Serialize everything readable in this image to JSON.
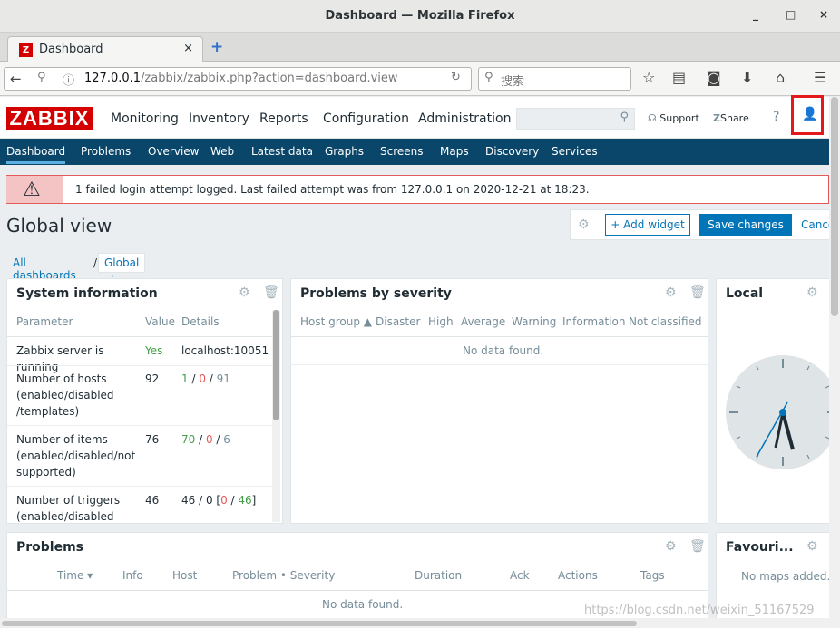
{
  "window": {
    "title": "Dashboard — Mozilla Firefox",
    "controls": [
      "_",
      "□",
      "×"
    ]
  },
  "tab": {
    "favicon": "Z",
    "label": "Dashboard",
    "close": "×",
    "new_tab": "+"
  },
  "nav": {
    "url_host": "127.0.0.1",
    "url_path": "/zabbix/zabbix.php?action=dashboard.view",
    "search_placeholder": "搜索",
    "icons": [
      "back-arrow-icon",
      "site-info-icon",
      "reload-icon",
      "bookmark-star-icon",
      "reading-list-icon",
      "pocket-icon",
      "download-icon",
      "home-icon",
      "menu-icon"
    ]
  },
  "zabbix": {
    "logo": "ZABBIX",
    "menu": [
      "Monitoring",
      "Inventory",
      "Reports",
      "Configuration",
      "Administration"
    ],
    "support": "Support",
    "share": "Share",
    "help": "?",
    "submenu": [
      "Dashboard",
      "Problems",
      "Overview",
      "Web",
      "Latest data",
      "Graphs",
      "Screens",
      "Maps",
      "Discovery",
      "Services"
    ]
  },
  "alert": {
    "message": "1 failed login attempt logged. Last failed attempt was from 127.0.0.1 on 2020-12-21 at 18:23."
  },
  "page": {
    "title": "Global view",
    "add_widget": "+ Add widget",
    "save_changes": "Save changes",
    "cancel": "Cance",
    "crumbs": {
      "all": "All dashboards",
      "sep": "/",
      "current": "Global view"
    }
  },
  "sysinfo": {
    "title": "System information",
    "headers": [
      "Parameter",
      "Value",
      "Details"
    ],
    "rows": [
      {
        "param": "Zabbix server is running",
        "value": "Yes",
        "details": "localhost:10051"
      },
      {
        "param": "Number of hosts (enabled/disabled /templates)",
        "value": "92",
        "d1": "1",
        "d2": "0",
        "d3": "91"
      },
      {
        "param": "Number of items (enabled/disabled/not supported)",
        "value": "76",
        "d1": "70",
        "d2": "0",
        "d3": "6"
      },
      {
        "param": "Number of triggers (enabled/disabled",
        "value": "46",
        "d0": "46 / 0 [",
        "d1": "0",
        "d2": "46",
        "d3": "]"
      }
    ]
  },
  "severity": {
    "title": "Problems by severity",
    "headers": [
      "Host group ▲",
      "Disaster",
      "High",
      "Average",
      "Warning",
      "Information",
      "Not classified"
    ],
    "nodata": "No data found."
  },
  "local": {
    "title": "Local"
  },
  "problems": {
    "title": "Problems",
    "headers": [
      "Time ▾",
      "Info",
      "Host",
      "Problem • Severity",
      "Duration",
      "Ack",
      "Actions",
      "Tags"
    ],
    "nodata": "No data found."
  },
  "favourites": {
    "title": "Favouri...",
    "nodata": "No maps added."
  },
  "watermark": "https://blog.csdn.net/weixin_51167529",
  "colors": {
    "brand_red": "#d40000",
    "nav_blue": "#0a466a",
    "link_blue": "#0275b8",
    "ok_green": "#429e47",
    "problem_red": "#e45959"
  }
}
